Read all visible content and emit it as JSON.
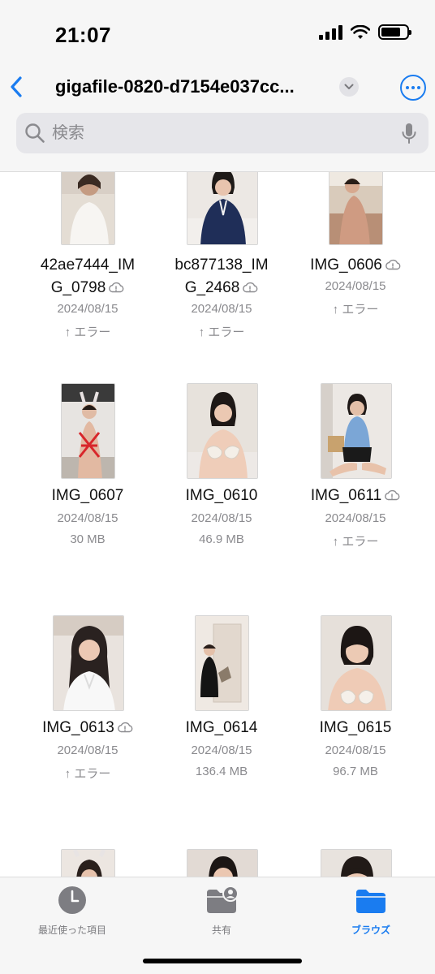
{
  "status": {
    "time": "21:07",
    "battery_level": 0.75
  },
  "nav": {
    "title": "gigafile-0820-d7154e037cc...",
    "search_placeholder": "検索"
  },
  "files": [
    {
      "name": "42ae7444_IMG_0798",
      "line1": "42ae7444_IM",
      "line2": "G_0798",
      "date": "2024/08/15",
      "meta": "↑ エラー",
      "cloud": true
    },
    {
      "name": "bc877138_IMG_2468",
      "line1": "bc877138_IM",
      "line2": "G_2468",
      "date": "2024/08/15",
      "meta": "↑ エラー",
      "cloud": true
    },
    {
      "name": "IMG_0606",
      "line1": "IMG_0606",
      "line2": "",
      "date": "2024/08/15",
      "meta": "↑ エラー",
      "cloud": true
    },
    {
      "name": "IMG_0607",
      "line1": "IMG_0607",
      "line2": "",
      "date": "2024/08/15",
      "meta": "30 MB",
      "cloud": false
    },
    {
      "name": "IMG_0610",
      "line1": "IMG_0610",
      "line2": "",
      "date": "2024/08/15",
      "meta": "46.9 MB",
      "cloud": false
    },
    {
      "name": "IMG_0611",
      "line1": "IMG_0611",
      "line2": "",
      "date": "2024/08/15",
      "meta": "↑ エラー",
      "cloud": true
    },
    {
      "name": "IMG_0613",
      "line1": "IMG_0613",
      "line2": "",
      "date": "2024/08/15",
      "meta": "↑ エラー",
      "cloud": true
    },
    {
      "name": "IMG_0614",
      "line1": "IMG_0614",
      "line2": "",
      "date": "2024/08/15",
      "meta": "136.4 MB",
      "cloud": false
    },
    {
      "name": "IMG_0615",
      "line1": "IMG_0615",
      "line2": "",
      "date": "2024/08/15",
      "meta": "96.7 MB",
      "cloud": false
    }
  ],
  "tabs": [
    {
      "label": "最近使った項目",
      "icon": "clock-icon",
      "active": false
    },
    {
      "label": "共有",
      "icon": "shared-folder-icon",
      "active": false
    },
    {
      "label": "ブラウズ",
      "icon": "folder-icon",
      "active": true
    }
  ],
  "colors": {
    "accent": "#1a7cf0",
    "secondary_text": "#8a8a8e"
  }
}
